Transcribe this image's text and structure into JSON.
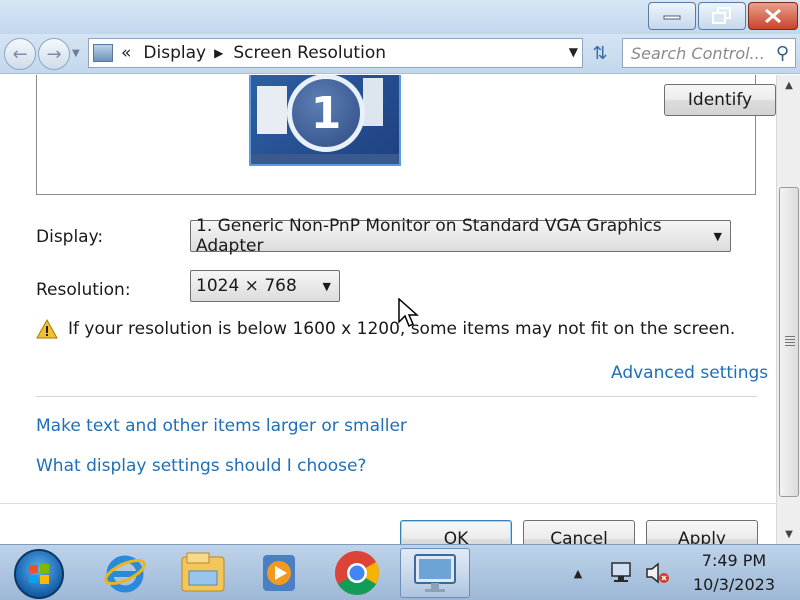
{
  "address": {
    "chevrons": "«",
    "crumbs": [
      "Display",
      "Screen Resolution"
    ]
  },
  "search": {
    "placeholder": "Search Control..."
  },
  "preview": {
    "monitor_number": "1",
    "identify_label": "Identify"
  },
  "form": {
    "display_label": "Display:",
    "display_value": "1. Generic Non-PnP Monitor on Standard VGA Graphics Adapter",
    "resolution_label": "Resolution:",
    "resolution_value": "1024 × 768",
    "warning": "If your resolution is below 1600 x 1200, some items may not fit on the screen."
  },
  "links": {
    "advanced": "Advanced settings",
    "text_size": "Make text and other items larger or smaller",
    "help": "What display settings should I choose?"
  },
  "buttons": {
    "ok": "OK",
    "cancel": "Cancel",
    "apply": "Apply"
  },
  "taskbar": {
    "time": "7:49 PM",
    "date": "10/3/2023"
  },
  "colors": {
    "link": "#1e6fb8",
    "taskbar": "#9db8d6",
    "close": "#c7442a"
  }
}
